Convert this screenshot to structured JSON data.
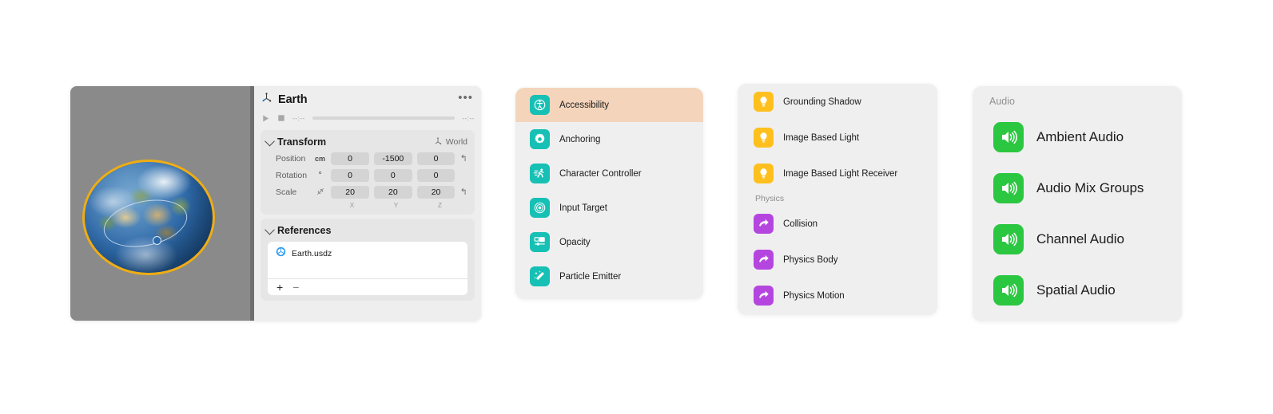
{
  "inspector": {
    "header": {
      "icon": "transform-gizmo-icon",
      "title": "Earth",
      "menu": "•••"
    },
    "transport": {
      "play_icon": "play-icon",
      "stop_icon": "stop-icon",
      "time_start": "--:--",
      "time_end": "--:--"
    },
    "transform": {
      "title": "Transform",
      "coordinate_space": "World",
      "space_icon": "coordinate-space-icon",
      "rows": [
        {
          "label": "Position",
          "unit": "cm",
          "unit_kind": "text",
          "x": "0",
          "y": "-1500",
          "z": "0",
          "revert": true
        },
        {
          "label": "Rotation",
          "unit": "°",
          "unit_kind": "text",
          "x": "0",
          "y": "0",
          "z": "0",
          "revert": false
        },
        {
          "label": "Scale",
          "unit": "link-icon",
          "unit_kind": "icon",
          "x": "20",
          "y": "20",
          "z": "20",
          "revert": true
        }
      ],
      "axis_labels": [
        "X",
        "Y",
        "Z"
      ]
    },
    "references": {
      "title": "References",
      "items": [
        {
          "icon": "usdz-cube-icon",
          "name": "Earth.usdz"
        }
      ],
      "add_label": "+",
      "remove_label": "−"
    }
  },
  "panels": {
    "general": {
      "items": [
        {
          "label": "Accessibility",
          "icon": "accessibility-icon",
          "color": "#16C0B4",
          "selected": true
        },
        {
          "label": "Anchoring",
          "icon": "gear-icon",
          "color": "#16C0B4",
          "selected": false
        },
        {
          "label": "Character Controller",
          "icon": "running-person-icon",
          "color": "#16C0B4",
          "selected": false
        },
        {
          "label": "Input Target",
          "icon": "target-icon",
          "color": "#16C0B4",
          "selected": false
        },
        {
          "label": "Opacity",
          "icon": "opacity-icon",
          "color": "#16C0B4",
          "selected": false
        },
        {
          "label": "Particle Emitter",
          "icon": "sparkle-wand-icon",
          "color": "#16C0B4",
          "selected": false
        }
      ],
      "selected_color": "#F4D5BB"
    },
    "lighting_physics": {
      "items": [
        {
          "label": "Grounding Shadow",
          "icon": "lightbulb-icon",
          "color": "#FFC01E",
          "type": "item"
        },
        {
          "label": "Image Based Light",
          "icon": "lightbulb-icon",
          "color": "#FFC01E",
          "type": "item"
        },
        {
          "label": "Image Based Light Receiver",
          "icon": "lightbulb-icon",
          "color": "#FFC01E",
          "type": "item"
        },
        {
          "label": "Physics",
          "type": "group"
        },
        {
          "label": "Collision",
          "icon": "curved-arrow-icon",
          "color": "#B446DF",
          "type": "item"
        },
        {
          "label": "Physics Body",
          "icon": "curved-arrow-icon",
          "color": "#B446DF",
          "type": "item"
        },
        {
          "label": "Physics Motion",
          "icon": "curved-arrow-icon",
          "color": "#B446DF",
          "type": "item"
        }
      ]
    },
    "audio": {
      "group_label": "Audio",
      "items": [
        {
          "label": "Ambient Audio",
          "icon": "speaker-wave-icon",
          "color": "#2CC741"
        },
        {
          "label": "Audio Mix Groups",
          "icon": "speaker-wave-icon",
          "color": "#2CC741"
        },
        {
          "label": "Channel Audio",
          "icon": "speaker-wave-icon",
          "color": "#2CC741"
        },
        {
          "label": "Spatial Audio",
          "icon": "speaker-wave-icon",
          "color": "#2CC741"
        }
      ]
    }
  },
  "viewport": {
    "name": "3d-scene-viewport",
    "object": "Earth",
    "selection_outline_color": "#F0AD12"
  }
}
